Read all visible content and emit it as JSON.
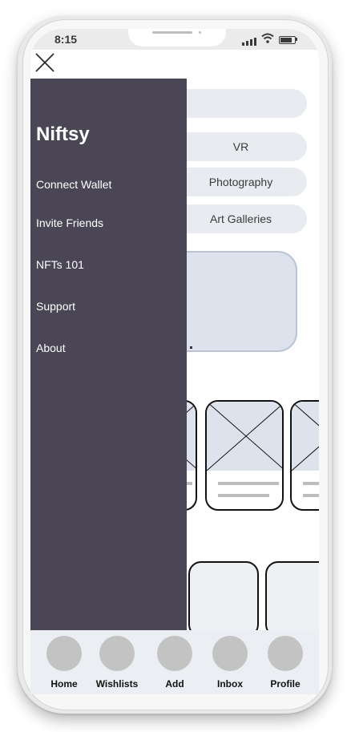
{
  "status_bar": {
    "time": "8:15"
  },
  "menu": {
    "title": "Niftsy",
    "items": [
      {
        "label": "Connect Wallet"
      },
      {
        "label": "Invite Friends"
      },
      {
        "label": "NFTs 101"
      },
      {
        "label": "Support"
      },
      {
        "label": "About"
      }
    ]
  },
  "categories": [
    {
      "label": ""
    },
    {
      "label": "VR"
    },
    {
      "label": "Photography"
    },
    {
      "label": "Art Galleries"
    }
  ],
  "tab_bar": {
    "items": [
      {
        "label": "Home"
      },
      {
        "label": "Wishlists"
      },
      {
        "label": "Add"
      },
      {
        "label": "Inbox"
      },
      {
        "label": "Profile"
      }
    ]
  },
  "icons": {
    "close": "close-icon",
    "signal": "signal-icon",
    "wifi": "wifi-icon",
    "battery": "battery-icon",
    "image_placeholder": "image-placeholder-icon"
  },
  "colors": {
    "drawer_bg": "#4a4656",
    "pill_bg": "#e8ecf0",
    "banner_bg": "#dde3ec",
    "tab_circle": "#c3c3c3"
  }
}
